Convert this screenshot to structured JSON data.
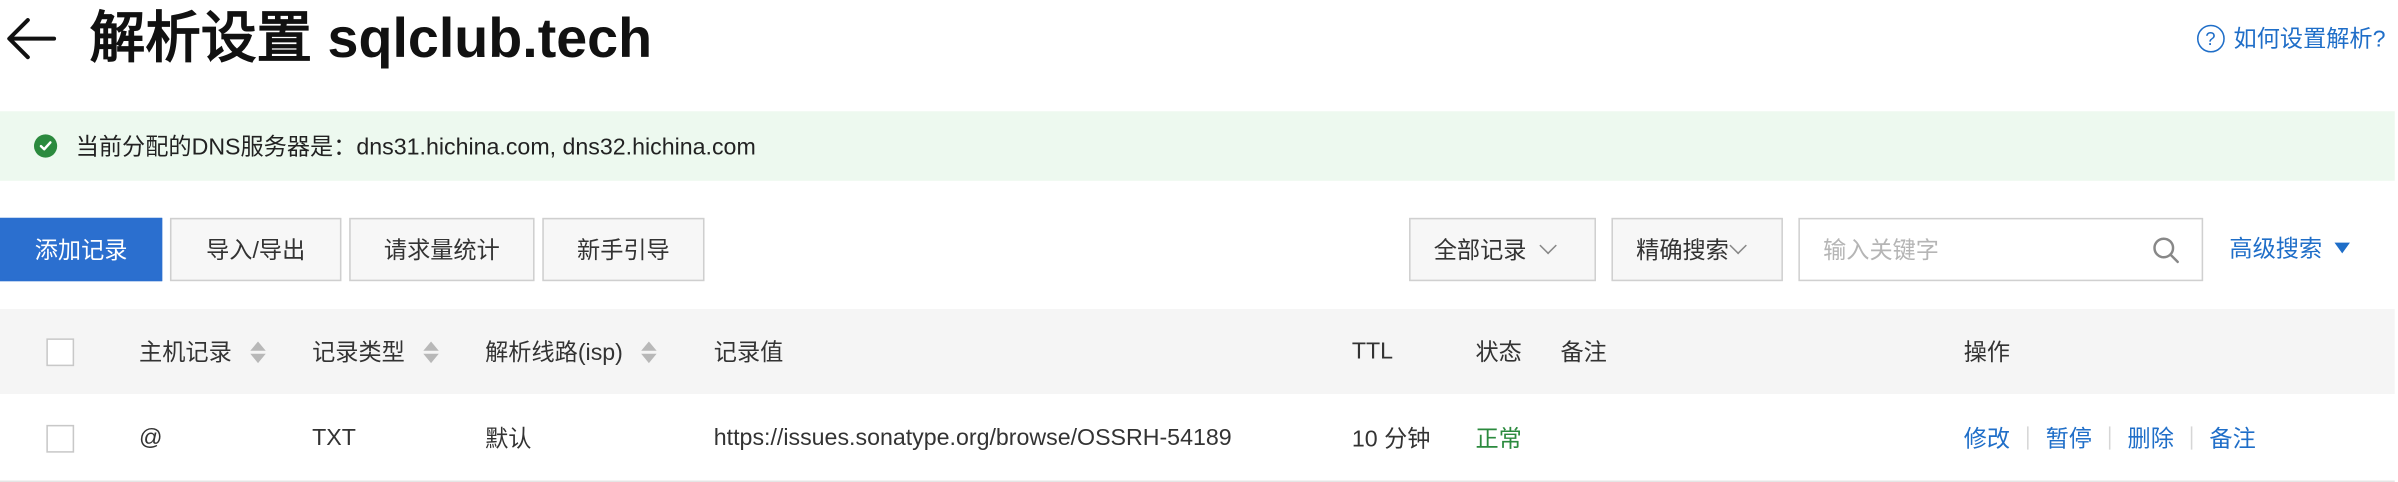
{
  "header": {
    "title": "解析设置 sqlclub.tech",
    "help_label": "如何设置解析?",
    "help_icon_glyph": "?"
  },
  "banner": {
    "text": "当前分配的DNS服务器是：dns31.hichina.com, dns32.hichina.com",
    "icon": "check-circle-icon",
    "bg_color": "#edf9ef",
    "icon_color": "#2b8a3e"
  },
  "toolbar": {
    "add_label": "添加记录",
    "import_export_label": "导入/导出",
    "stats_label": "请求量统计",
    "guide_label": "新手引导",
    "record_filter_value": "全部记录",
    "search_mode_value": "精确搜索",
    "search_placeholder": "输入关键字",
    "advanced_search_label": "高级搜索"
  },
  "table": {
    "columns": {
      "host": "主机记录",
      "type": "记录类型",
      "line": "解析线路(isp)",
      "value": "记录值",
      "ttl": "TTL",
      "status": "状态",
      "remark": "备注",
      "actions": "操作"
    },
    "rows": [
      {
        "host": "@",
        "type": "TXT",
        "line": "默认",
        "value": "https://issues.sonatype.org/browse/OSSRH-54189",
        "ttl": "10 分钟",
        "status": "正常",
        "remark": "",
        "actions": [
          "修改",
          "暂停",
          "删除",
          "备注"
        ]
      }
    ]
  },
  "colors": {
    "primary": "#2b6fcf",
    "link": "#1f6ec8",
    "success": "#2b8a3e"
  }
}
